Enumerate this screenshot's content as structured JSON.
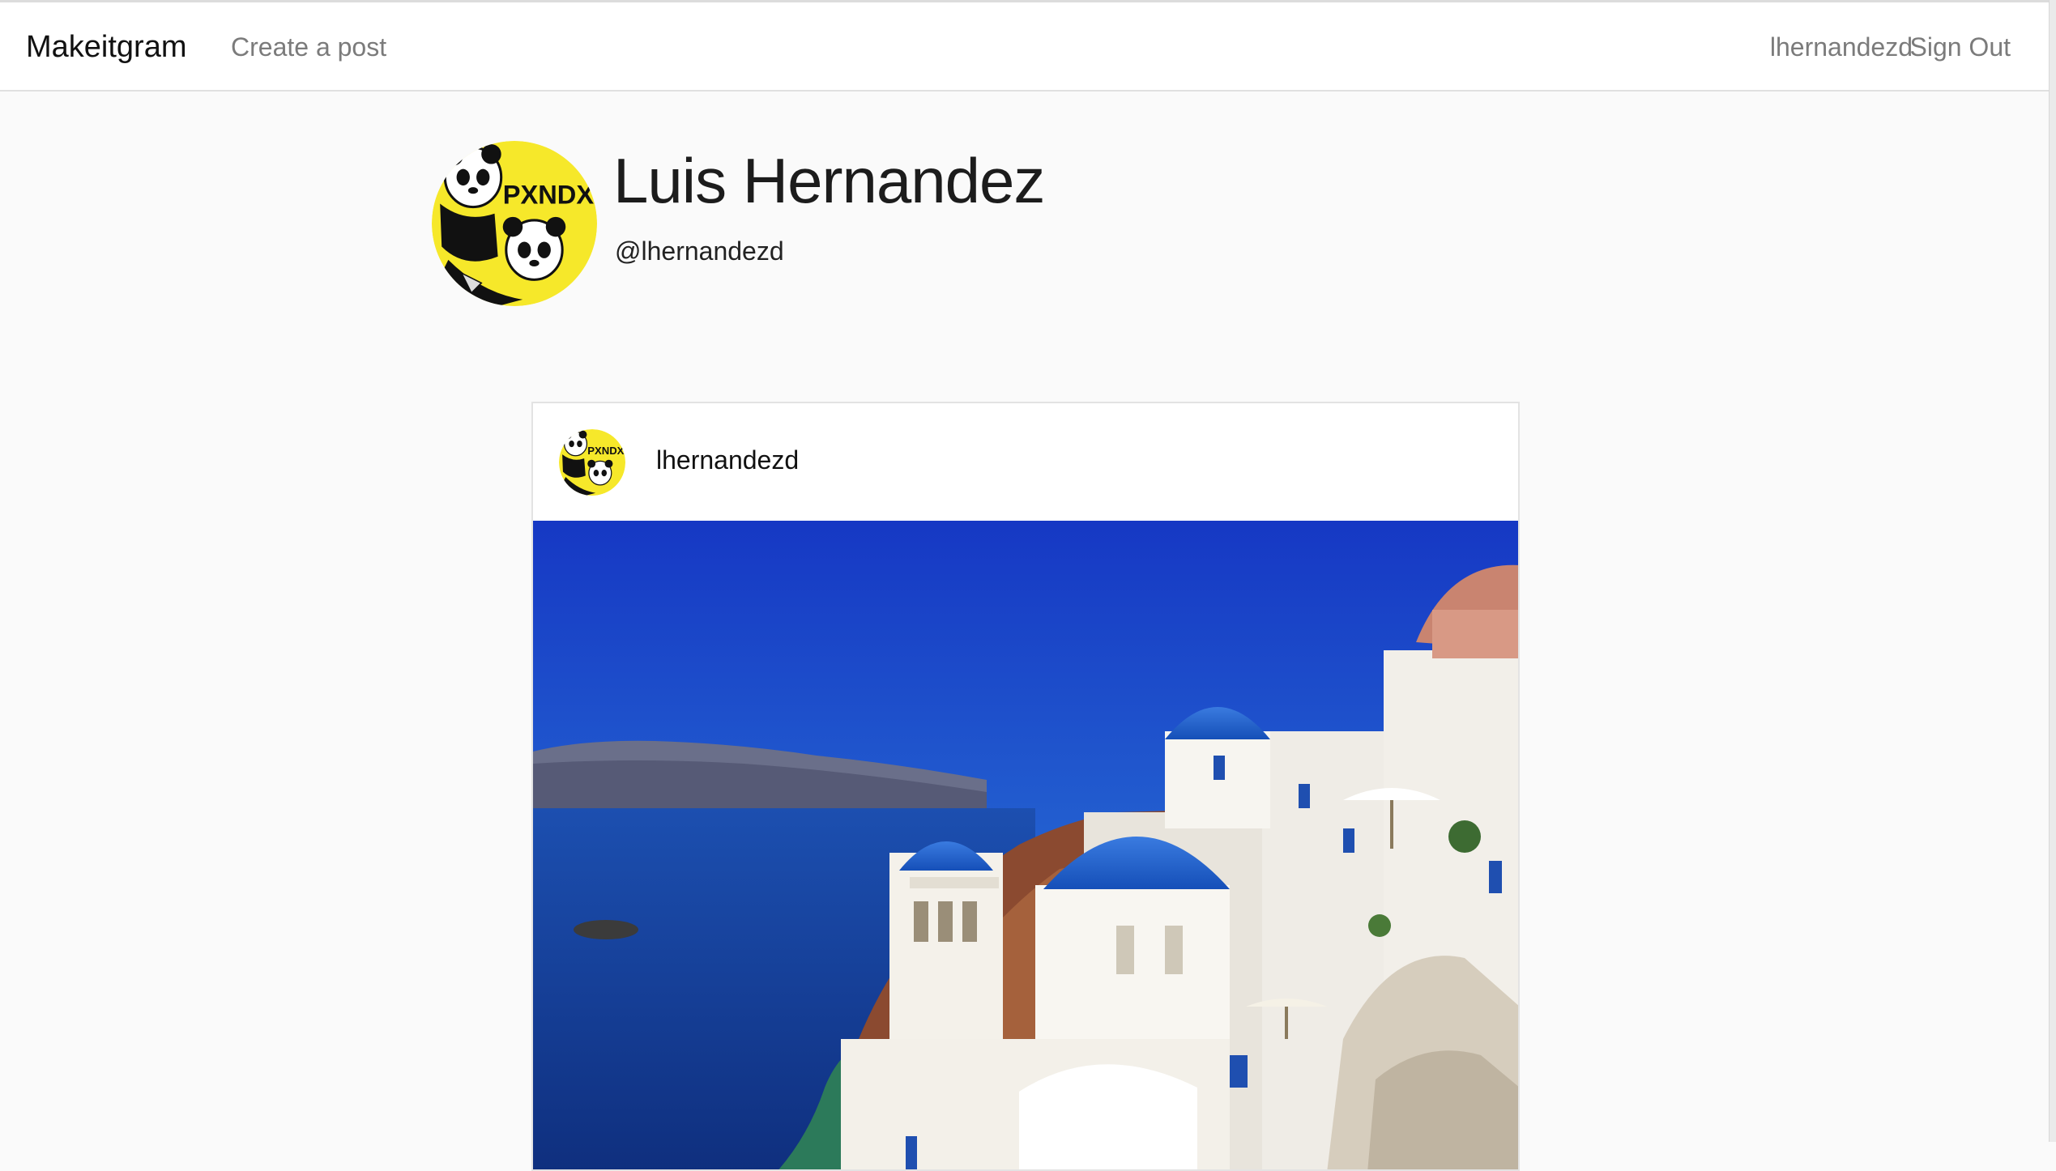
{
  "nav": {
    "brand": "Makeitgram",
    "create_post": "Create a post",
    "username": "lhernandezd",
    "sign_out": "Sign Out"
  },
  "profile": {
    "name": "Luis Hernandez",
    "handle": "@lhernandezd",
    "avatar_text": "PXNDX"
  },
  "post": {
    "username": "lhernandezd",
    "avatar_text": "PXNDX",
    "image_subject": "Santorini blue-domed churches over the sea"
  },
  "colors": {
    "nav_bg": "#ffffff",
    "page_bg": "#fafafa",
    "avatar_yellow": "#f6e82a",
    "dome_blue": "#1f5fc4",
    "sky_blue": "#1a3fc8",
    "sea_blue": "#163c9a"
  }
}
